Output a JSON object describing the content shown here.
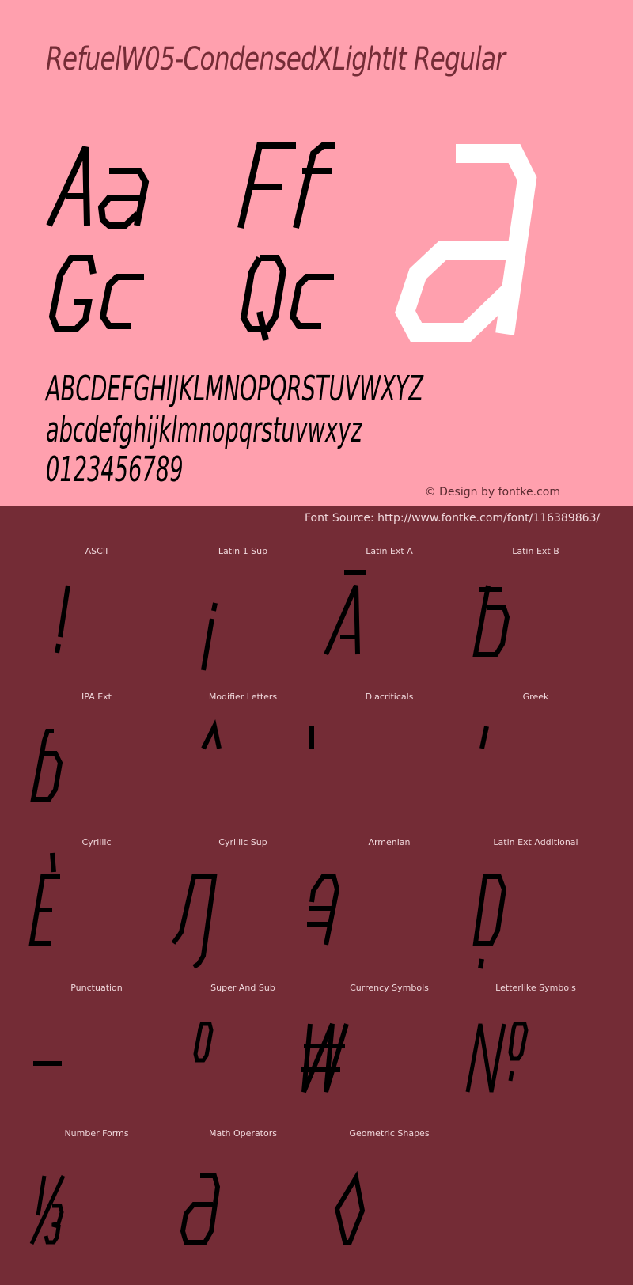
{
  "header": {
    "font_name": "RefuelW05-CondensedXLightIt Regular"
  },
  "preview": {
    "pairs": [
      "Aa",
      "Ff",
      "Gg",
      "Qq"
    ],
    "big_glyph": "a",
    "uppercase": "ABCDEFGHIJKLMNOPQRSTUVWXYZ",
    "lowercase": "abcdefghijklmnopqrstuvwxyz",
    "digits": "0123456789"
  },
  "credit": "© Design by fontke.com",
  "source": "Font Source: http://www.fontke.com/font/116389863/",
  "colors": {
    "top_bg": "#FFA0AE",
    "bottom_bg": "#742C36",
    "title_text": "#742C36",
    "glyph": "#000000",
    "big_glyph": "#FFFFFF",
    "label_text": "#F0D8DC"
  },
  "blocks": [
    {
      "label": "ASCII",
      "glyph": "!"
    },
    {
      "label": "Latin 1 Sup",
      "glyph": "¡"
    },
    {
      "label": "Latin Ext A",
      "glyph": "Ā"
    },
    {
      "label": "Latin Ext B",
      "glyph": "ƀ"
    },
    {
      "label": "IPA Ext",
      "glyph": "ɓ"
    },
    {
      "label": "Modifier Letters",
      "glyph": "ˆ"
    },
    {
      "label": "Diacriticals",
      "glyph": "̍"
    },
    {
      "label": "Greek",
      "glyph": "΄"
    },
    {
      "label": "Cyrillic",
      "glyph": "Ѐ"
    },
    {
      "label": "Cyrillic Sup",
      "glyph": "Ԓ"
    },
    {
      "label": "Armenian",
      "glyph": "Ձ"
    },
    {
      "label": "Latin Ext Additional",
      "glyph": "Ḍ"
    },
    {
      "label": "Punctuation",
      "glyph": "–"
    },
    {
      "label": "Super And Sub",
      "glyph": "⁰"
    },
    {
      "label": "Currency Symbols",
      "glyph": "₩"
    },
    {
      "label": "Letterlike Symbols",
      "glyph": "№"
    },
    {
      "label": "Number Forms",
      "glyph": "⅓"
    },
    {
      "label": "Math Operators",
      "glyph": "∂"
    },
    {
      "label": "Geometric Shapes",
      "glyph": "◊"
    }
  ]
}
